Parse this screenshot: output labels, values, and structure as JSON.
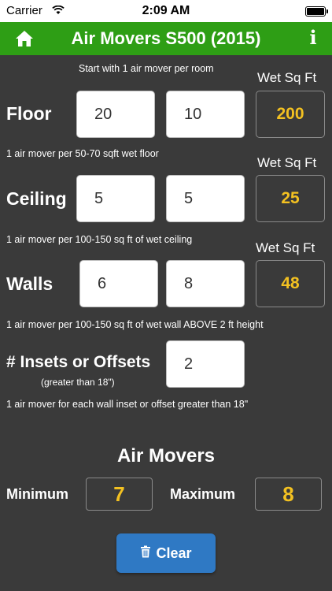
{
  "status_bar": {
    "carrier": "Carrier",
    "time": "2:09 AM"
  },
  "nav": {
    "title": "Air Movers S500 (2015)",
    "info_label": "i",
    "home_icon": "home-icon"
  },
  "intro_hint": "Start with 1 air mover per room",
  "wet_sq_ft_label": "Wet Sq Ft",
  "floor": {
    "label": "Floor",
    "length": "20",
    "width": "10",
    "area": "200",
    "hint": "1 air mover per 50-70 sqft wet floor"
  },
  "ceiling": {
    "label": "Ceiling",
    "length": "5",
    "width": "5",
    "area": "25",
    "hint": "1 air mover per 100-150 sq ft of wet ceiling"
  },
  "walls": {
    "label": "Walls",
    "length": "6",
    "width": "8",
    "area": "48",
    "hint": "1 air mover per 100-150 sq ft of wet wall ABOVE 2 ft height"
  },
  "insets": {
    "label": "# Insets or Offsets",
    "sublabel": "(greater than 18\")",
    "value": "2",
    "hint": "1 air mover for each wall inset or offset greater than 18\""
  },
  "results": {
    "title": "Air Movers",
    "min_label": "Minimum",
    "min_value": "7",
    "max_label": "Maximum",
    "max_value": "8"
  },
  "clear_button": {
    "label": "Clear",
    "icon": "trash-icon"
  },
  "colors": {
    "nav_green": "#2e9e15",
    "background": "#3a3a3a",
    "accent_yellow": "#f3c121",
    "button_blue": "#2f79c4"
  }
}
